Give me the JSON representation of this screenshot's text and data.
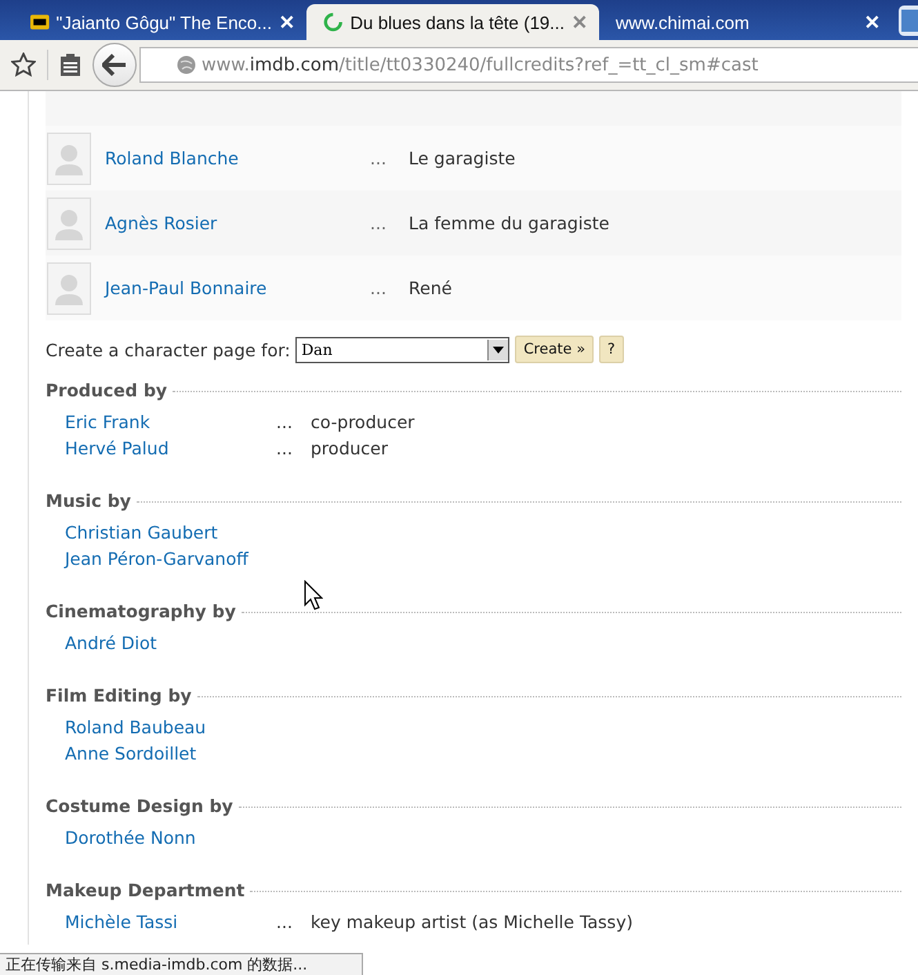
{
  "tabs": [
    {
      "label": "\"Jaianto Gôgu\" The Enco...",
      "kind": "logo",
      "selected": false,
      "close": "✕"
    },
    {
      "label": "Du blues dans la tête (19...",
      "kind": "loading",
      "selected": true,
      "close": "✕"
    },
    {
      "label": "www.chimai.com",
      "kind": "none",
      "selected": false,
      "close": "✕"
    }
  ],
  "address": {
    "host_prefix": "www.",
    "host": "imdb.com",
    "path": "/title/tt0330240/fullcredits?ref_=tt_cl_sm#cast"
  },
  "cast": [
    {
      "name": "Roland Blanche",
      "dots": "...",
      "character": "Le garagiste"
    },
    {
      "name": "Agnès Rosier",
      "dots": "...",
      "character": "La femme du garagiste"
    },
    {
      "name": "Jean-Paul Bonnaire",
      "dots": "...",
      "character": "René"
    }
  ],
  "character_page": {
    "label": "Create a character page for:",
    "value": "Dan",
    "create_button": "Create »",
    "help_button": "?"
  },
  "sections": [
    {
      "title": "Produced by",
      "credits": [
        {
          "name": "Eric Frank",
          "dots": "...",
          "role": "co-producer"
        },
        {
          "name": "Hervé Palud",
          "dots": "...",
          "role": "producer"
        }
      ]
    },
    {
      "title": "Music by",
      "credits": [
        {
          "name": "Christian Gaubert"
        },
        {
          "name": "Jean Péron-Garvanoff"
        }
      ]
    },
    {
      "title": "Cinematography by",
      "credits": [
        {
          "name": "André Diot"
        }
      ]
    },
    {
      "title": "Film Editing by",
      "credits": [
        {
          "name": "Roland Baubeau"
        },
        {
          "name": "Anne Sordoillet"
        }
      ]
    },
    {
      "title": "Costume Design by",
      "credits": [
        {
          "name": "Dorothée Nonn"
        }
      ]
    },
    {
      "title": "Makeup Department",
      "credits": [
        {
          "name": "Michèle Tassi",
          "dots": "...",
          "role": "key makeup artist (as Michelle Tassy)"
        }
      ]
    }
  ],
  "status_bar": "正在传输来自 s.media-imdb.com 的数据..."
}
